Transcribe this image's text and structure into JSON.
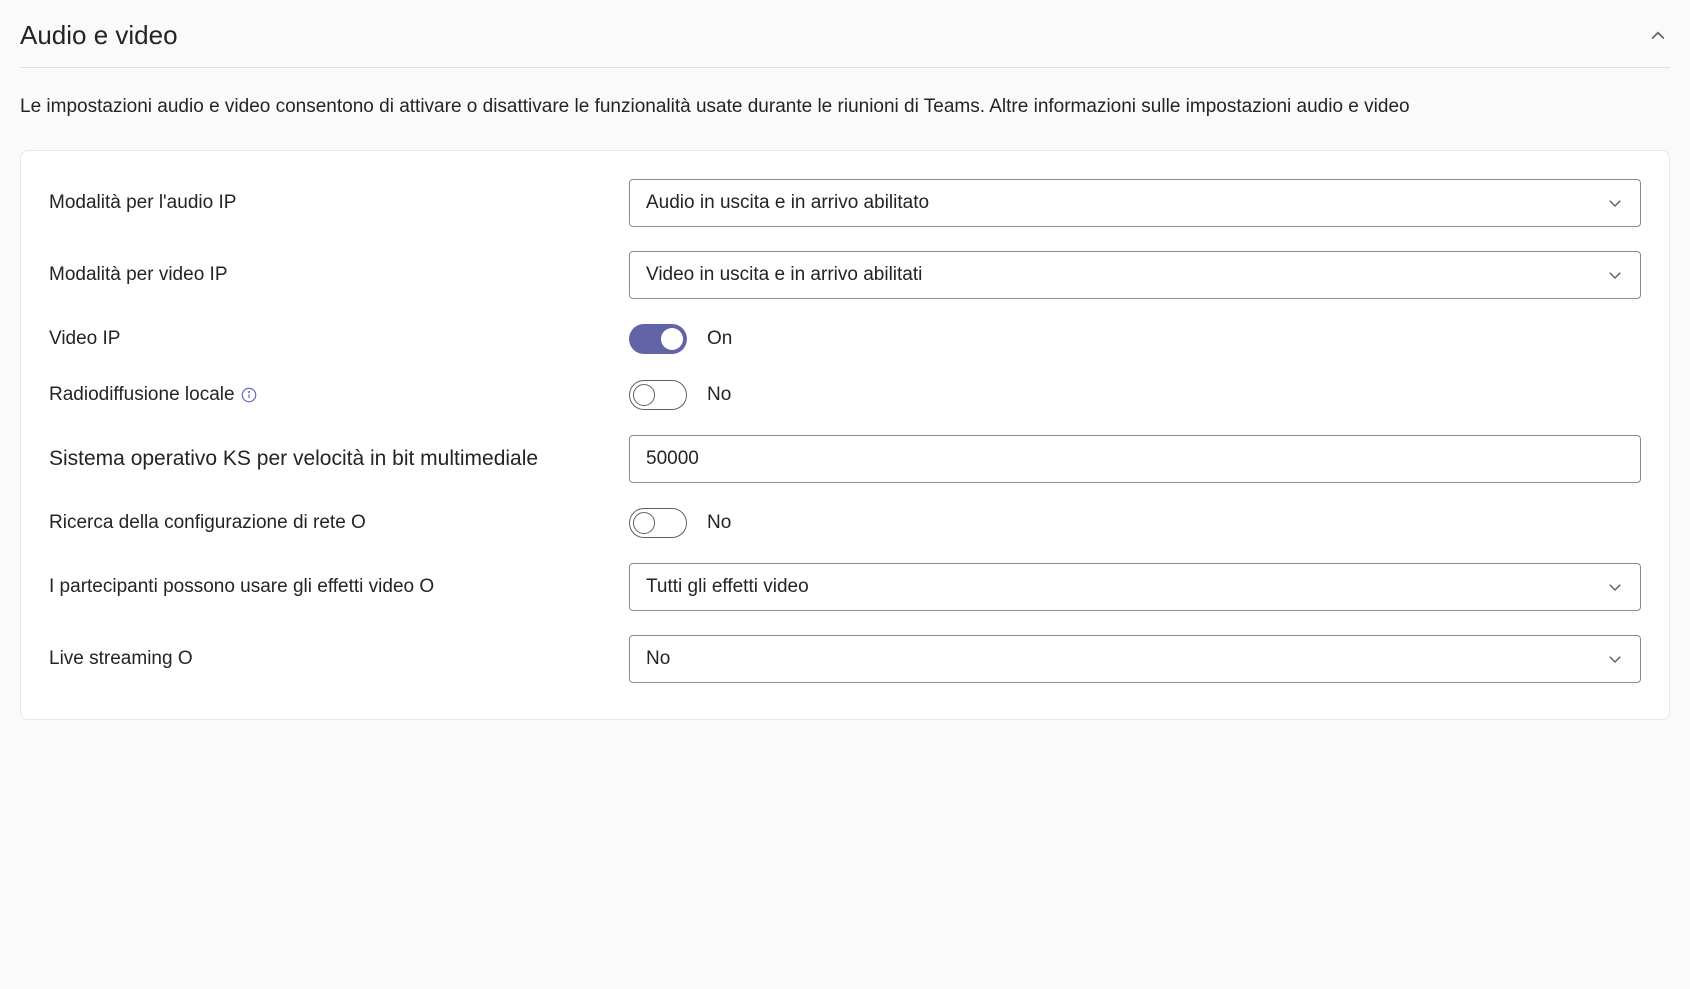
{
  "section": {
    "title": "Audio e video",
    "description": "Le impostazioni audio e video consentono di attivare o disattivare le funzionalità usate durante le riunioni di Teams. Altre informazioni sulle impostazioni audio e video"
  },
  "rows": {
    "ip_audio_mode": {
      "label": "Modalità per l'audio IP",
      "value": "Audio in uscita e in arrivo abilitato"
    },
    "ip_video_mode": {
      "label": "Modalità per video IP",
      "value": "Video in uscita e in arrivo abilitati"
    },
    "ip_video": {
      "label": "Video IP",
      "state": "On"
    },
    "local_broadcast": {
      "label": "Radiodiffusione locale",
      "state": "No"
    },
    "media_bitrate": {
      "label": "Sistema operativo KS per velocità in bit multimediale",
      "value": "50000"
    },
    "network_config": {
      "label": "Ricerca della configurazione di rete O",
      "state": "No"
    },
    "video_effects": {
      "label": "I partecipanti possono usare gli effetti video O",
      "value": "Tutti gli effetti video"
    },
    "live_streaming": {
      "label": "Live streaming O",
      "value": "No"
    }
  }
}
